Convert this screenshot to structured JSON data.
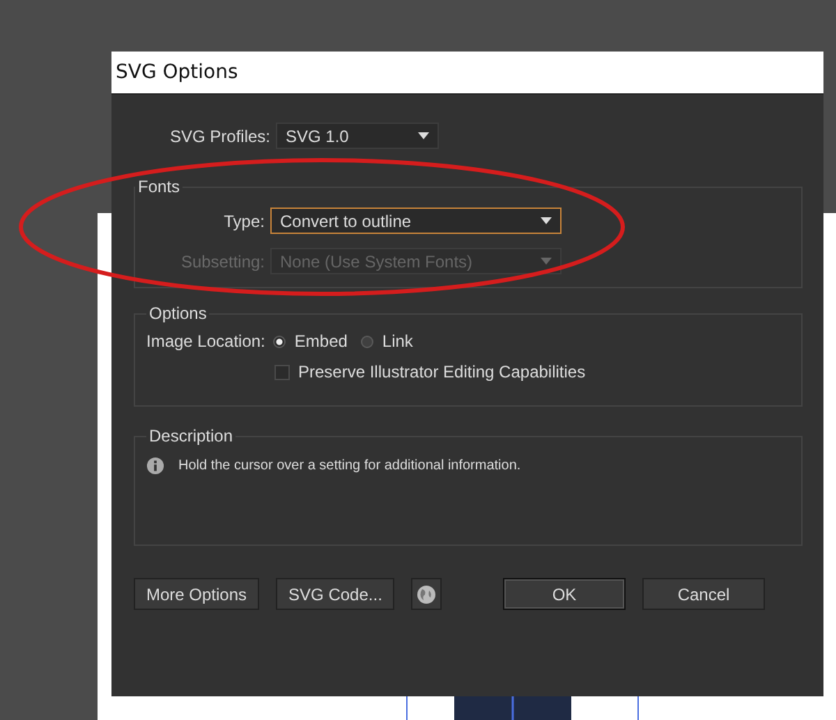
{
  "window": {
    "title": "SVG Options"
  },
  "profiles": {
    "label": "SVG Profiles:",
    "value": "SVG 1.0"
  },
  "fonts": {
    "title": "Fonts",
    "type": {
      "label": "Type:",
      "value": "Convert to outline",
      "focused": true,
      "disabled": false
    },
    "subsetting": {
      "label": "Subsetting:",
      "value": "None (Use System Fonts)",
      "focused": false,
      "disabled": true
    }
  },
  "options": {
    "title": "Options",
    "image_location": {
      "label": "Image Location:",
      "choices": [
        {
          "label": "Embed",
          "selected": true
        },
        {
          "label": "Link",
          "selected": false
        }
      ]
    },
    "preserve": {
      "label": "Preserve Illustrator Editing Capabilities",
      "checked": false
    }
  },
  "description": {
    "title": "Description",
    "text": "Hold the cursor over a setting for additional information."
  },
  "buttons": [
    {
      "kind": "text",
      "label": "More Options",
      "default": false
    },
    {
      "kind": "text",
      "label": "SVG Code...",
      "default": false
    },
    {
      "kind": "globe",
      "default": false
    },
    {
      "kind": "text",
      "label": "OK",
      "default": true
    },
    {
      "kind": "text",
      "label": "Cancel",
      "default": false
    }
  ]
}
